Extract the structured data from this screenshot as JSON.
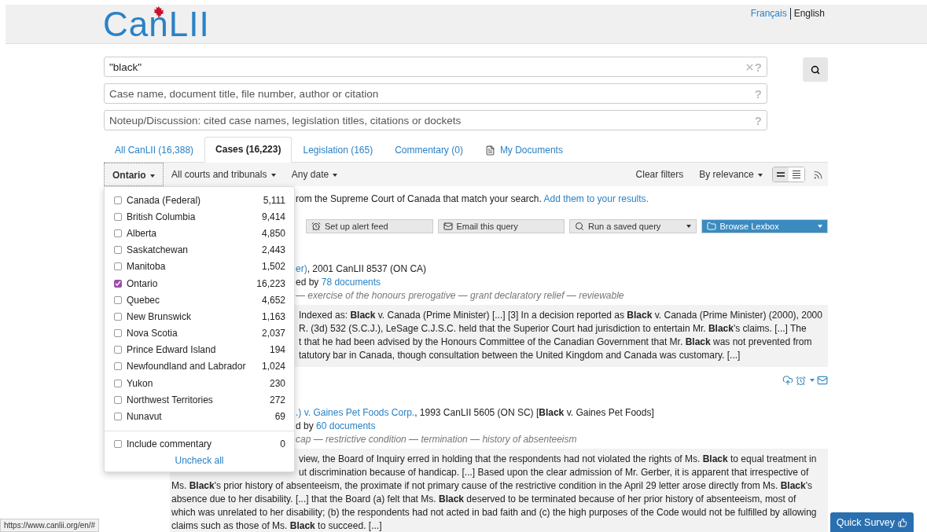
{
  "header": {
    "logo": "CanLII",
    "languages": [
      {
        "label": "Français",
        "selected": false
      },
      {
        "label": "English",
        "selected": true
      }
    ]
  },
  "search": {
    "fields": [
      {
        "value": "\"black\"",
        "clearable": true,
        "help": "?"
      },
      {
        "placeholder": "Case name, document title, file number, author or citation",
        "clearable": false,
        "help": "?"
      },
      {
        "placeholder": "Noteup/Discussion: cited case names, legislation titles, citations or dockets",
        "clearable": false,
        "help": "?"
      }
    ]
  },
  "tabs": [
    {
      "label": "All CanLII (16,388)",
      "selected": false
    },
    {
      "label": "Cases (16,223)",
      "selected": true
    },
    {
      "label": "Legislation (165)",
      "selected": false
    },
    {
      "label": "Commentary (0)",
      "selected": false
    },
    {
      "label": "My Documents",
      "selected": false,
      "kind": "documents"
    }
  ],
  "filters": {
    "left": [
      "Ontario",
      "All courts and tribunals",
      "Any date"
    ],
    "clear": "Clear filters",
    "sort": "By relevance"
  },
  "jurisdiction_menu": {
    "items": [
      {
        "label": "Canada (Federal)",
        "count": "5,111",
        "checked": false
      },
      {
        "label": "British Columbia",
        "count": "9,414",
        "checked": false
      },
      {
        "label": "Alberta",
        "count": "4,850",
        "checked": false
      },
      {
        "label": "Saskatchewan",
        "count": "2,443",
        "checked": false
      },
      {
        "label": "Manitoba",
        "count": "1,502",
        "checked": false
      },
      {
        "label": "Ontario",
        "count": "16,223",
        "checked": true
      },
      {
        "label": "Quebec",
        "count": "4,652",
        "checked": false
      },
      {
        "label": "New Brunswick",
        "count": "1,163",
        "checked": false
      },
      {
        "label": "Nova Scotia",
        "count": "2,037",
        "checked": false
      },
      {
        "label": "Prince Edward Island",
        "count": "194",
        "checked": false
      },
      {
        "label": "Newfoundland and Labrador",
        "count": "1,024",
        "checked": false
      },
      {
        "label": "Yukon",
        "count": "230",
        "checked": false
      },
      {
        "label": "Northwest Territories",
        "count": "272",
        "checked": false
      },
      {
        "label": "Nunavut",
        "count": "69",
        "checked": false
      }
    ],
    "commentary": {
      "label": "Include commentary",
      "count": "0",
      "checked": false
    },
    "uncheck_all": "Uncheck all"
  },
  "notice": {
    "text": "rom the Supreme Court of Canada that match your search.",
    "link": "Add them to your results."
  },
  "toolbar": [
    {
      "label": "Set up alert feed",
      "kind": "alarm"
    },
    {
      "label": "Email this query",
      "kind": "email"
    },
    {
      "label": "Run a saved query",
      "kind": "saved"
    },
    {
      "label": "Browse Lexbox",
      "kind": "lexbox"
    }
  ],
  "results": [
    {
      "title_link": "er)",
      "title_rest": ", 2001 CanLII 8537 (ON CA)",
      "cited_prefix": "ed by",
      "cited_link": "78 documents",
      "keywords": "— exercise of the honours prerogative — grant declaratory relief — reviewable",
      "snippet": [
        {
          "text": "Indexed as: **Black** v. Canada (Prime Minister)   [...]   [3] In a decision reported as **Black** v. Canada (Prime Minister) (2000), 2000",
          "covered": true
        },
        {
          "text": "R. (3d) 532 (S.C.J.), LeSage C.J.S.C. held that the Superior Court had jurisdiction to entertain Mr. **Black**'s claims.   [...]   The",
          "covered": true
        },
        {
          "text": "t that he had been advised by the Honours Committee of the Canadian Government that Mr. **Black** was not prevented from",
          "covered": true
        },
        {
          "text": "tatutory bar in Canada, though consultation between the United Kingdom and Canada was customary.   [...]",
          "covered": true
        }
      ]
    },
    {
      "title_link": ".) v. Gaines Pet Foods Corp.",
      "title_rest": ", 1993 CanLII 5605 (ON SC)  [**Black** v. Gaines Pet Foods]",
      "cited_prefix": "d by",
      "cited_link": "60 documents",
      "keywords": "cap — restrictive condition — termination — history of absenteeism",
      "snippet": [
        {
          "text": "view, the Board of Inquiry erred in holding that the respondents had not violated the rights of Ms. **Black** to equal treatment in",
          "covered": true
        },
        {
          "text": "ut discrimination because of handicap.   [...]   Based upon the clear admission of Mr. Gerber, it is apparent that irrespective of",
          "covered": true
        },
        {
          "text": "Ms. **Black**'s prior history of absenteeism, the proximate if not primary cause of the restrictive condition in the April 29 letter arose directly from Ms. **Black**'s",
          "covered": false
        },
        {
          "text": "absence due to her disability.   [...]   that the Board (a) felt that Ms. **Black** deserved to be terminated because of her prior history of absenteeism, most of",
          "covered": false
        },
        {
          "text": "which was unrelated to her disability; (b) the respondents had not acted in bad faith and (c) the high purposes of the Code would not be fulfilled by allowing",
          "covered": false
        },
        {
          "text": "claims such as those of Ms. **Black** to succeed.   [...]",
          "covered": false
        }
      ]
    }
  ],
  "status_url": "https://www.canlii.org/en/#",
  "survey_button": "Quick Survey"
}
